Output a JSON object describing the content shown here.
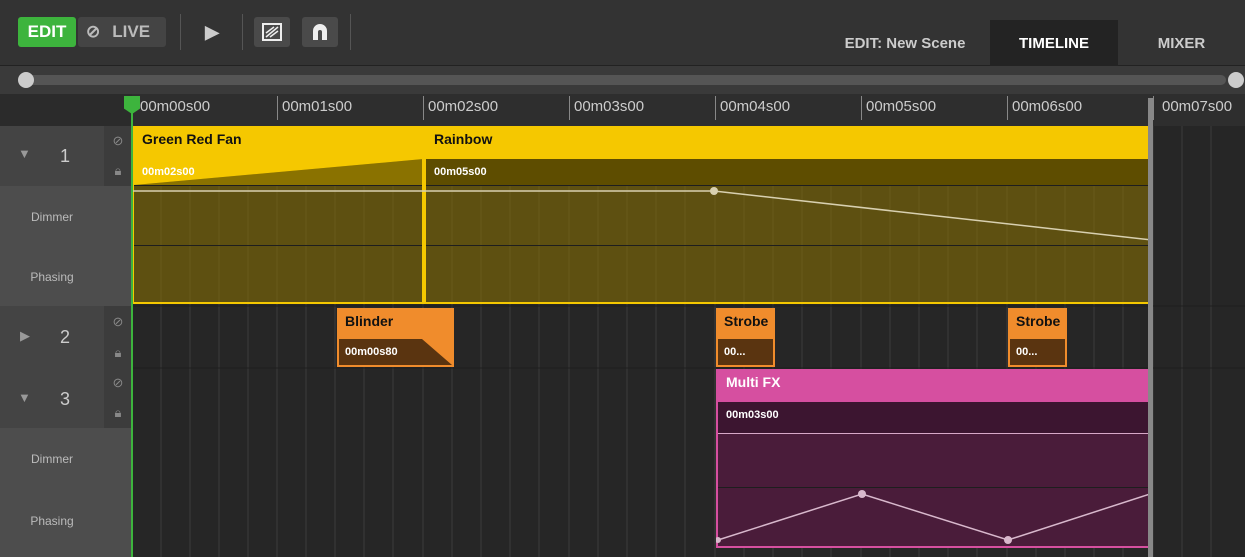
{
  "toolbar": {
    "edit_label": "EDIT",
    "live_label": "LIVE",
    "play_icon": "play-icon",
    "fx_icon": "fx-icon",
    "magnet_icon": "magnet-icon",
    "scene_label": "EDIT: New Scene",
    "tabs": [
      {
        "label": "TIMELINE",
        "active": true
      },
      {
        "label": "MIXER",
        "active": false
      }
    ]
  },
  "ruler": {
    "ticks": [
      "00m00s00",
      "00m01s00",
      "00m02s00",
      "00m03s00",
      "00m04s00",
      "00m05s00",
      "00m06s00",
      "00m07s00"
    ]
  },
  "tracks": [
    {
      "number": "1",
      "expanded": true,
      "params": [
        "Dimmer",
        "Phasing"
      ]
    },
    {
      "number": "2",
      "expanded": false,
      "params": []
    },
    {
      "number": "3",
      "expanded": true,
      "params": [
        "Dimmer",
        "Phasing"
      ]
    }
  ],
  "clips": {
    "green_red_fan": {
      "title": "Green Red Fan",
      "duration": "00m02s00"
    },
    "rainbow": {
      "title": "Rainbow",
      "duration": "00m05s00"
    },
    "blinder": {
      "title": "Blinder",
      "duration": "00m00s80"
    },
    "strobe1": {
      "title": "Strobe",
      "duration": "00..."
    },
    "strobe2": {
      "title": "Strobe",
      "duration": "00..."
    },
    "multifx": {
      "title": "Multi FX",
      "duration": "00m03s00"
    }
  },
  "colors": {
    "yellow": "#f5c800",
    "orange": "#f08c2c",
    "pink": "#d64fa0",
    "green": "#3db43d"
  }
}
